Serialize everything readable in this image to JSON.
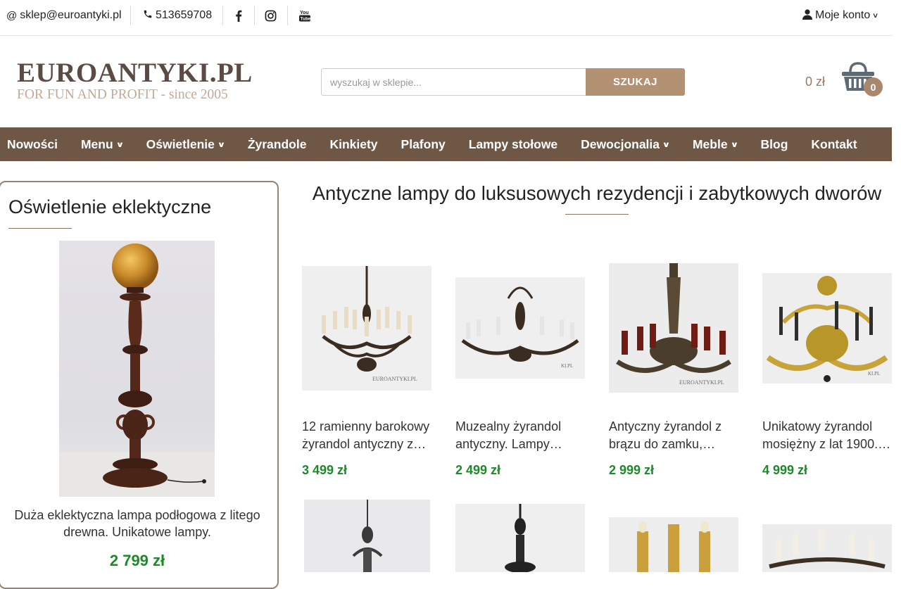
{
  "topbar": {
    "email": "sklep@euroantyki.pl",
    "phone": "513659708",
    "account": "Moje konto"
  },
  "logo": {
    "main": "EUROANTYKI.PL",
    "sub": "FOR FUN AND PROFIT - since 2005"
  },
  "search": {
    "placeholder": "wyszukaj w sklepie...",
    "button": "SZUKAJ"
  },
  "cart": {
    "total": "0 zł",
    "count": "0"
  },
  "nav": [
    {
      "label": "Nowości"
    },
    {
      "label": "Menu"
    },
    {
      "label": "Oświetlenie"
    },
    {
      "label": "Żyrandole"
    },
    {
      "label": "Kinkiety"
    },
    {
      "label": "Plafony"
    },
    {
      "label": "Lampy stołowe"
    },
    {
      "label": "Dewocjonalia"
    },
    {
      "label": "Meble"
    },
    {
      "label": "Blog"
    },
    {
      "label": "Kontakt"
    }
  ],
  "sidebar": {
    "title": "Oświetlenie eklektyczne",
    "product_name": "Duża eklektyczna lampa podłogowa z litego drewna. Unikatowe lampy.",
    "product_price": "2 799 zł"
  },
  "main": {
    "title": "Antyczne lampy do luksusowych rezydencji i zabytkowych dworów",
    "products": [
      {
        "name": "12 ramienny barokowy żyrandol antyczny z…",
        "price": "3 499 zł"
      },
      {
        "name": "Muzealny żyrandol antyczny. Lampy…",
        "price": "2 499 zł"
      },
      {
        "name": "Antyczny żyrandol z brązu do zamku,…",
        "price": "2 999 zł"
      },
      {
        "name": "Unikatowy żyrandol mosiężny z lat 1900.…",
        "price": "4 999 zł"
      }
    ]
  },
  "colors": {
    "nav_bg": "#6f5745",
    "accent": "#b39274",
    "price": "#1d8a2a"
  }
}
